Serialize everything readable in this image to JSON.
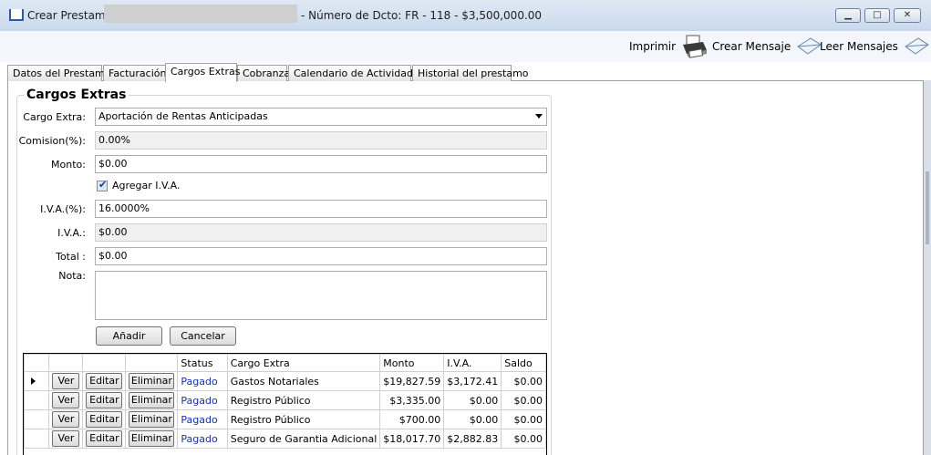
{
  "window": {
    "title_left": "Crear Prestamo",
    "title_right": "- Número de Dcto: FR - 118 - $3,500,000.00",
    "min_symbol": "▁",
    "max_symbol": "□",
    "close_symbol": "✕"
  },
  "toolbar": {
    "print_label": "Imprimir",
    "create_message_label": "Crear Mensaje",
    "read_messages_label": "Leer Mensajes"
  },
  "tabs": [
    {
      "label": "Datos del Prestamo"
    },
    {
      "label": "Facturación"
    },
    {
      "label": "Cargos Extras"
    },
    {
      "label": "Cobranza"
    },
    {
      "label": "Calendario de Actividades"
    },
    {
      "label": "Historial del prestamo"
    }
  ],
  "form": {
    "group_title": "Cargos Extras",
    "cargo_extra_label": "Cargo Extra:",
    "cargo_extra_value": "Aportación de Rentas Anticipadas",
    "comision_label": "Comision(%):",
    "comision_value": "0.00%",
    "monto_label": "Monto:",
    "monto_value": "$0.00",
    "agregar_iva_label": "Agregar I.V.A.",
    "agregar_iva_checked": true,
    "iva_pct_label": "I.V.A.(%):",
    "iva_pct_value": "16.0000%",
    "iva_label": "I.V.A.:",
    "iva_value": "$0.00",
    "total_label": "Total :",
    "total_value": "$0.00",
    "nota_label": "Nota:",
    "nota_value": "",
    "add_button": "Añadir",
    "cancel_button": "Cancelar"
  },
  "grid": {
    "headers": [
      "Status",
      "Cargo Extra",
      "Monto",
      "I.V.A.",
      "Saldo"
    ],
    "ver_label": "Ver",
    "edit_label": "Editar",
    "delete_label": "Eliminar",
    "rows": [
      {
        "status": "Pagado",
        "cargo": "Gastos Notariales",
        "monto": "$19,827.59",
        "iva": "$3,172.41",
        "saldo": "$0.00"
      },
      {
        "status": "Pagado",
        "cargo": "Registro Público",
        "monto": "$3,335.00",
        "iva": "$0.00",
        "saldo": "$0.00"
      },
      {
        "status": "Pagado",
        "cargo": "Registro Público",
        "monto": "$700.00",
        "iva": "$0.00",
        "saldo": "$0.00"
      },
      {
        "status": "Pagado",
        "cargo": "Seguro de Garantia Adicional",
        "monto": "$18,017.70",
        "iva": "$2,882.83",
        "saldo": "$0.00"
      }
    ]
  }
}
